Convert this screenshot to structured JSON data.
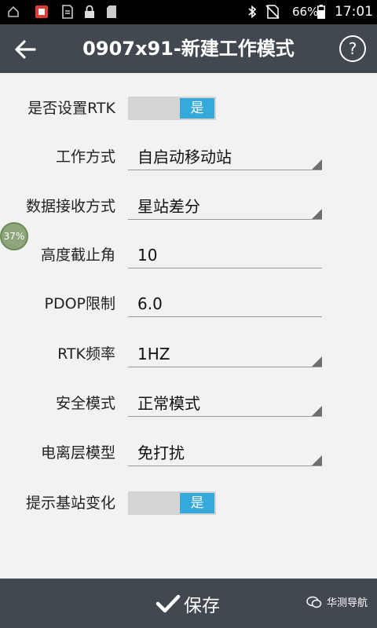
{
  "status_bar": {
    "battery": "66%",
    "time": "17:01"
  },
  "app_bar": {
    "back_icon": "back-arrow-icon",
    "title": "0907x91-新建工作模式",
    "help_icon": "help-icon",
    "help_glyph": "?"
  },
  "form": {
    "rtk": {
      "label": "是否设置RTK",
      "state": "是"
    },
    "work_mode": {
      "label": "工作方式",
      "value": "自启动移动站"
    },
    "data_receive": {
      "label": "数据接收方式",
      "value": "星站差分"
    },
    "cutoff_angle": {
      "label": "高度截止角",
      "value": "10"
    },
    "pdop": {
      "label": "PDOP限制",
      "value": "6.0"
    },
    "rtk_freq": {
      "label": "RTK频率",
      "value": "1HZ"
    },
    "safety_mode": {
      "label": "安全模式",
      "value": "正常模式"
    },
    "iono_model": {
      "label": "电离层模型",
      "value": "免打扰"
    },
    "base_change": {
      "label": "提示基站变化",
      "state": "是"
    }
  },
  "overlay_badge": "37%",
  "bottom_bar": {
    "save_label": "保存",
    "watermark": "华测导航"
  },
  "colors": {
    "toolbar": "#414850",
    "accent": "#35a9da",
    "background": "#f2f2f2"
  }
}
